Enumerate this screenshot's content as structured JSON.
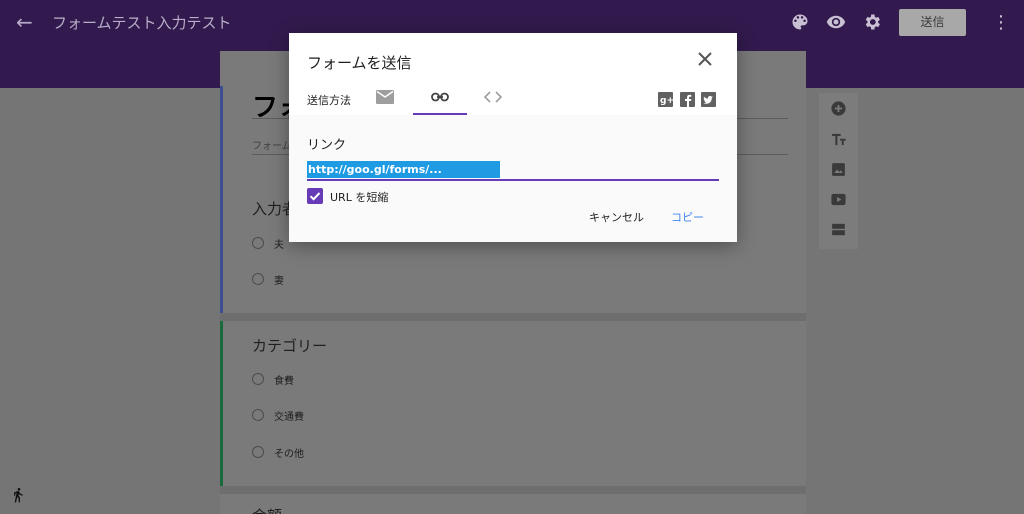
{
  "app": {
    "back_icon": "arrow-back-icon",
    "title": "フォームテスト入力テスト",
    "send_label": "送信",
    "accent_color": "#673ab7"
  },
  "form": {
    "title": "フォ",
    "description": "フォーム",
    "question1": {
      "title": "入力者",
      "options": [
        "夫",
        "妻"
      ]
    },
    "question2": {
      "title": "カテゴリー",
      "options": [
        "食費",
        "交通費",
        "その他"
      ]
    },
    "question3": {
      "title": "金額"
    }
  },
  "modal": {
    "title": "フォームを送信",
    "send_method_label": "送信方法",
    "tabs": [
      "email-icon",
      "link-icon",
      "embed-code-icon"
    ],
    "active_tab": "link-icon",
    "link_label": "リンク",
    "url_value": "http://goo.gl/forms/...",
    "shorten_label": "URL を短縮",
    "shorten_checked": true,
    "cancel_label": "キャンセル",
    "copy_label": "コピー"
  }
}
